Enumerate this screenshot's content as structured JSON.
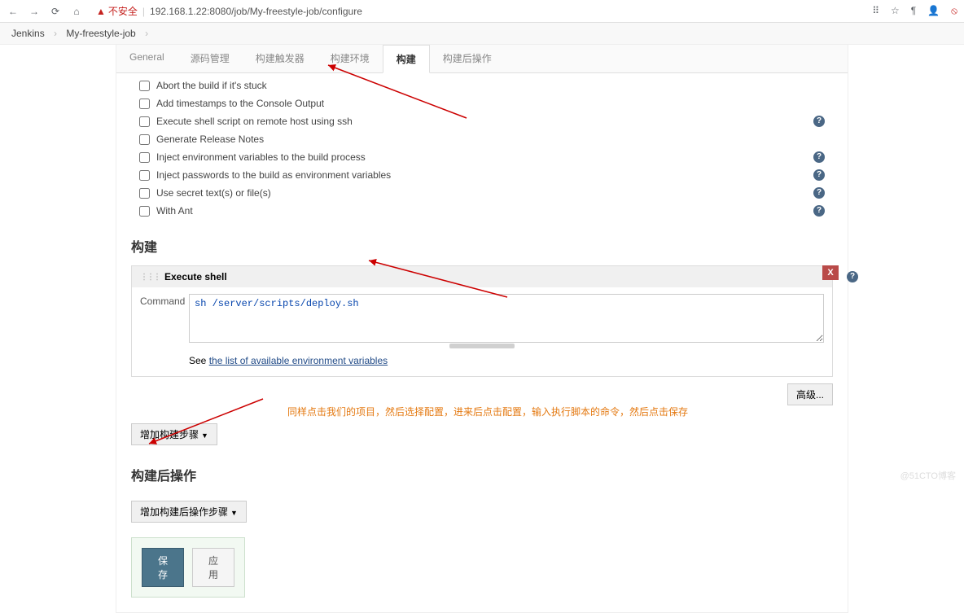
{
  "browser": {
    "url": "192.168.1.22:8080/job/My-freestyle-job/configure",
    "insecure_label": "不安全"
  },
  "breadcrumb": {
    "root": "Jenkins",
    "job": "My-freestyle-job"
  },
  "tabs": {
    "general": "General",
    "scm": "源码管理",
    "triggers": "构建触发器",
    "env": "构建环境",
    "build": "构建",
    "post": "构建后操作"
  },
  "env_checks": [
    {
      "label": "Abort the build if it's stuck",
      "help": false
    },
    {
      "label": "Add timestamps to the Console Output",
      "help": false
    },
    {
      "label": "Execute shell script on remote host using ssh",
      "help": true
    },
    {
      "label": "Generate Release Notes",
      "help": false
    },
    {
      "label": "Inject environment variables to the build process",
      "help": true
    },
    {
      "label": "Inject passwords to the build as environment variables",
      "help": true
    },
    {
      "label": "Use secret text(s) or file(s)",
      "help": true
    },
    {
      "label": "With Ant",
      "help": true
    }
  ],
  "build": {
    "title": "构建",
    "step_title": "Execute shell",
    "command_label": "Command",
    "command_value": "sh /server/scripts/deploy.sh",
    "env_link_prefix": "See ",
    "env_link_text": "the list of available environment variables",
    "advanced": "高级...",
    "add_step": "增加构建步骤",
    "close_x": "X"
  },
  "post": {
    "title": "构建后操作",
    "add_step": "增加构建后操作步骤"
  },
  "footer": {
    "save": "保存",
    "apply": "应用"
  },
  "annotation": "同样点击我们的项目，然后选择配置，进来后点击配置，输入执行脚本的命令，然后点击保存",
  "watermark": "@51CTO博客"
}
